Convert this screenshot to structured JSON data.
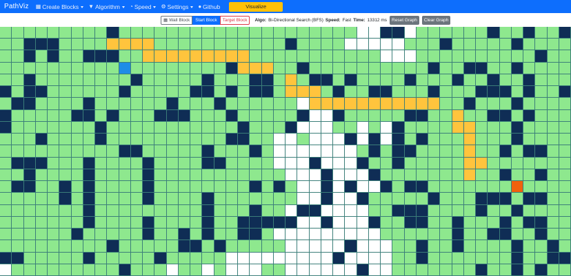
{
  "nav": {
    "brand": "PathViz",
    "items": [
      {
        "id": "create-blocks",
        "label": "Create Blocks",
        "icon": "squares-plus-icon",
        "glyph": "▦"
      },
      {
        "id": "algorithm",
        "label": "Algorithm",
        "icon": "filter-icon",
        "glyph": "▼"
      },
      {
        "id": "speed",
        "label": "Speed",
        "icon": "speedometer-icon",
        "glyph": "◔"
      },
      {
        "id": "settings",
        "label": "Settings",
        "icon": "gear-icon",
        "glyph": "⚙"
      },
      {
        "id": "github",
        "label": "Github",
        "icon": "github-icon",
        "glyph": "●"
      }
    ],
    "visualize": "Visualize"
  },
  "toolbar": {
    "wall_label": "Wall Block",
    "start_label": "Start Block",
    "target_label": "Target Block",
    "algo_label": "Algo:",
    "algo_value": "Bi-Directional Search (BFS)",
    "speed_label": "Speed:",
    "speed_value": "Fast",
    "time_label": "Time:",
    "time_value": "13312 ms",
    "reset_label": "Reset Graph",
    "clear_label": "Clear Graph"
  },
  "colors": {
    "empty": "#8ee88e",
    "wall": "#0f2d55",
    "visited": "#ffffff",
    "path": "#ffc43d",
    "start": "#1e8ce6",
    "target": "#f0610d",
    "navbar": "#0d6efd"
  },
  "grid": {
    "cols": 48,
    "rows": 21,
    "legend": {
      ".": "empty",
      "#": "wall",
      "o": "visited",
      "P": "path",
      "S": "start",
      "T": "target"
    },
    "cells": [
      ".........#....................oo##o......#..#..#",
      "..###....PPPP...........#....ooooo...#.....#....",
      "..#.#..###..PPPPPPPPP...........ooo..........#..",
      "..........S........#PPP..#..........#..##..#....",
      "..#........#.....#...##.P.##.#....#...#..#..#...",
      "#.##......#.....##.#.##.PPP.#..##...#...###.#..#",
      ".##....#......#...#......oPPPPPPPPPPP..#...#....",
      "#.....##.#...###...#.....#oo#.....##..P..##.#...",
      "#.......#...........#...#ooo..o.o#....PP...#....",
      "...#....#..........##..oo.ooo#o#o#.#...P...#....",
      "..........##.....#...#.ooooooo.#.##....P..#.##..",
      ".###...#....#....##....ooo#ooo#..#.....PP.......",
      "..#....#....#...........ooo#ooo#.......P..#..#..",
      ".##..#.#....#........#.#.oo#o#oo#.##.......T....",
      ".....#.#....#....#.......oo#oo#.....#...###.##..",
      ".......#.........#...#..o##oooo..###....#..#....",
      ".......#....#....#..#####oo#ooo#..##..#...#.##..",
      "......#.....#..#.#..##.ooooooooo......#..##..#..",
      ".........#.....##.#.....ooooo#ooo..#..#....#..#.",
      "##.....#.....#.....ooooooooo#oooo..#.......#..##",
      "o.........#...o..o.ooo..oooooo#oo.......#..#.#.."
    ]
  }
}
